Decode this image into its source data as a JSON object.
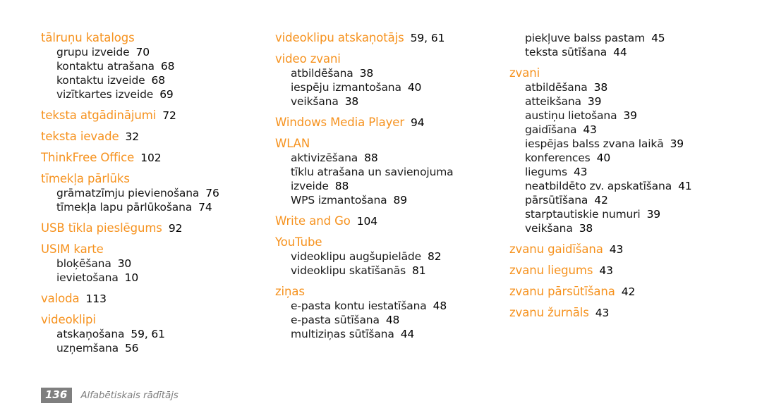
{
  "document": {
    "type": "index",
    "language": "lv",
    "accent_color": "#F6921E",
    "text_color": "#000000",
    "background_color": "#FFFFFF"
  },
  "footer": {
    "page_number": "136",
    "section_label": "Alfabētiskais rādītājs",
    "box_color": "#7F7F7F",
    "label_color": "#808080"
  },
  "columns": [
    {
      "name": "column-1",
      "entries": [
        {
          "kind": "head",
          "label": "tālruņu katalogs",
          "pages": ""
        },
        {
          "kind": "sub",
          "label": "grupu izveide",
          "pages": "70"
        },
        {
          "kind": "sub",
          "label": "kontaktu atrašana",
          "pages": "68"
        },
        {
          "kind": "sub",
          "label": "kontaktu izveide",
          "pages": "68"
        },
        {
          "kind": "sub",
          "label": "vizītkartes izveide",
          "pages": "69"
        },
        {
          "kind": "head",
          "label": "teksta atgādinājumi",
          "pages": "72"
        },
        {
          "kind": "head",
          "label": "teksta ievade",
          "pages": "32"
        },
        {
          "kind": "head",
          "label": "ThinkFree Office",
          "pages": "102"
        },
        {
          "kind": "head",
          "label": "tīmekļa pārlūks",
          "pages": ""
        },
        {
          "kind": "sub",
          "label": "grāmatzīmju pievienošana",
          "pages": "76"
        },
        {
          "kind": "sub",
          "label": "tīmekļa lapu pārlūkošana",
          "pages": "74"
        },
        {
          "kind": "head",
          "label": "USB tīkla pieslēgums",
          "pages": "92"
        },
        {
          "kind": "head",
          "label": "USIM karte",
          "pages": ""
        },
        {
          "kind": "sub",
          "label": "bloķēšana",
          "pages": "30"
        },
        {
          "kind": "sub",
          "label": "ievietošana",
          "pages": "10"
        },
        {
          "kind": "head",
          "label": "valoda",
          "pages": "113"
        },
        {
          "kind": "head",
          "label": "videoklipi",
          "pages": ""
        },
        {
          "kind": "sub",
          "label": "atskaņošana",
          "pages": "59, 61"
        },
        {
          "kind": "sub",
          "label": "uzņemšana",
          "pages": "56"
        }
      ]
    },
    {
      "name": "column-2",
      "entries": [
        {
          "kind": "head",
          "label": "videoklipu atskaņotājs",
          "pages": "59, 61"
        },
        {
          "kind": "head",
          "label": "video zvani",
          "pages": ""
        },
        {
          "kind": "sub",
          "label": "atbildēšana",
          "pages": "38"
        },
        {
          "kind": "sub",
          "label": "iespēju izmantošana",
          "pages": "40"
        },
        {
          "kind": "sub",
          "label": "veikšana",
          "pages": "38"
        },
        {
          "kind": "head",
          "label": "Windows Media Player",
          "pages": "94"
        },
        {
          "kind": "head",
          "label": "WLAN",
          "pages": ""
        },
        {
          "kind": "sub",
          "label": "aktivizēšana",
          "pages": "88"
        },
        {
          "kind": "sub",
          "label": "tīklu atrašana un savienojuma izveide",
          "pages": "88"
        },
        {
          "kind": "sub",
          "label": "WPS izmantošana",
          "pages": "89"
        },
        {
          "kind": "head",
          "label": "Write and Go",
          "pages": "104"
        },
        {
          "kind": "head",
          "label": "YouTube",
          "pages": ""
        },
        {
          "kind": "sub",
          "label": "videoklipu augšupielāde",
          "pages": "82"
        },
        {
          "kind": "sub",
          "label": "videoklipu skatīšanās",
          "pages": "81"
        },
        {
          "kind": "head",
          "label": "ziņas",
          "pages": ""
        },
        {
          "kind": "sub",
          "label": "e-pasta kontu iestatīšana",
          "pages": "48"
        },
        {
          "kind": "sub",
          "label": "e-pasta sūtīšana",
          "pages": "48"
        },
        {
          "kind": "sub",
          "label": "multiziņas sūtīšana",
          "pages": "44"
        }
      ]
    },
    {
      "name": "column-3",
      "entries": [
        {
          "kind": "sub",
          "label": "piekļuve balss pastam",
          "pages": "45"
        },
        {
          "kind": "sub",
          "label": "teksta sūtīšana",
          "pages": "44"
        },
        {
          "kind": "head",
          "label": "zvani",
          "pages": ""
        },
        {
          "kind": "sub",
          "label": "atbildēšana",
          "pages": "38"
        },
        {
          "kind": "sub",
          "label": "atteikšana",
          "pages": "39"
        },
        {
          "kind": "sub",
          "label": "austiņu lietošana",
          "pages": "39"
        },
        {
          "kind": "sub",
          "label": "gaidīšana",
          "pages": "43"
        },
        {
          "kind": "sub",
          "label": "iespējas balss zvana laikā",
          "pages": "39"
        },
        {
          "kind": "sub",
          "label": "konferences",
          "pages": "40"
        },
        {
          "kind": "sub",
          "label": "liegums",
          "pages": "43"
        },
        {
          "kind": "sub",
          "label": "neatbildēto zv. apskatīšana",
          "pages": "41"
        },
        {
          "kind": "sub",
          "label": "pārsūtīšana",
          "pages": "42"
        },
        {
          "kind": "sub",
          "label": "starptautiskie numuri",
          "pages": "39"
        },
        {
          "kind": "sub",
          "label": "veikšana",
          "pages": "38"
        },
        {
          "kind": "head",
          "label": "zvanu gaidīšana",
          "pages": "43"
        },
        {
          "kind": "head",
          "label": "zvanu liegums",
          "pages": "43"
        },
        {
          "kind": "head",
          "label": "zvanu pārsūtīšana",
          "pages": "42"
        },
        {
          "kind": "head",
          "label": "zvanu žurnāls",
          "pages": "43"
        }
      ]
    }
  ]
}
